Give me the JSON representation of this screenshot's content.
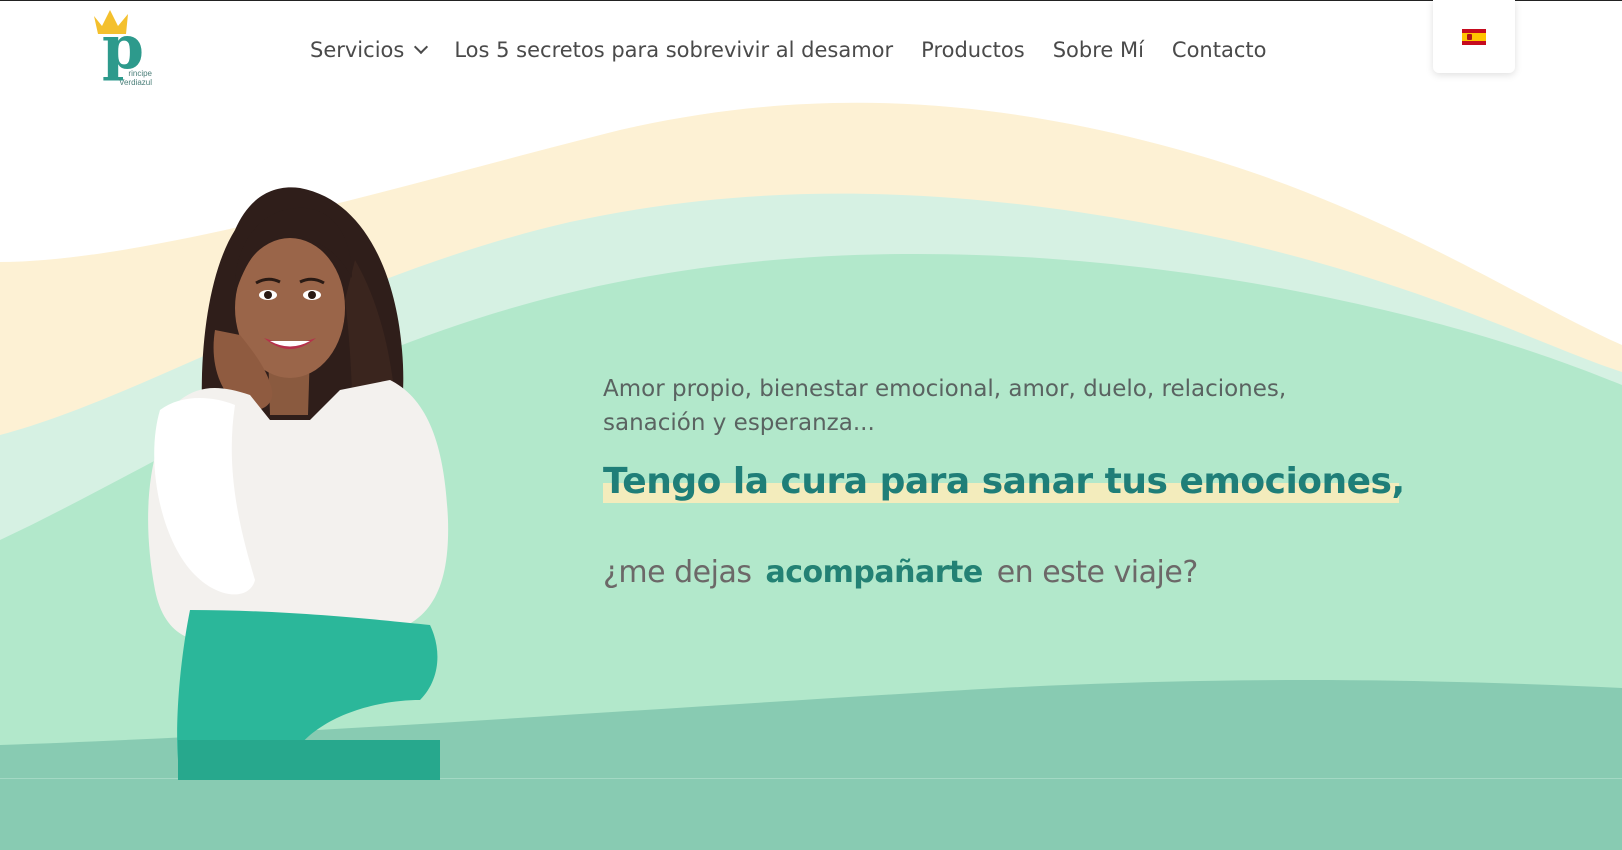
{
  "header": {
    "logo": {
      "letter": "p",
      "line1": "rincipe",
      "line2": "Verdiazul"
    },
    "nav": [
      {
        "label": "Servicios",
        "has_dropdown": true
      },
      {
        "label": "Los 5 secretos para sobrevivir al desamor"
      },
      {
        "label": "Productos"
      },
      {
        "label": "Sobre Mí"
      },
      {
        "label": "Contacto"
      }
    ],
    "language": {
      "icon": "flag-es-icon"
    }
  },
  "hero": {
    "intro": "Amor propio, bienestar emocional, amor, duelo, relaciones, sanación y esperanza...",
    "title": "Tengo la cura para sanar tus emociones,",
    "question_before": "¿me dejas",
    "question_accent": "acompañarte",
    "question_after": "en este viaje?"
  },
  "colors": {
    "brand_teal": "#1f7e78",
    "wave_cream": "#fdf1d4",
    "wave_pale_mint": "#d6f1e3",
    "wave_mint": "#b2e8cb",
    "wave_deep": "#88cbb2",
    "highlight": "#f3ecbc"
  }
}
